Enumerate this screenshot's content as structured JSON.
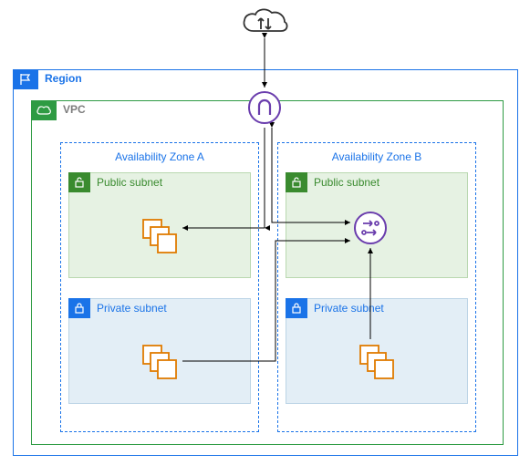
{
  "region": {
    "label": "Region"
  },
  "vpc": {
    "label": "VPC"
  },
  "availability_zones": {
    "a": {
      "label": "Availability Zone A",
      "public_subnet": {
        "label": "Public subnet",
        "resource": "instance-stack"
      },
      "private_subnet": {
        "label": "Private subnet",
        "resource": "instance-stack"
      }
    },
    "b": {
      "label": "Availability Zone B",
      "public_subnet": {
        "label": "Public subnet",
        "resource": "nat-gateway"
      },
      "private_subnet": {
        "label": "Private subnet",
        "resource": "instance-stack"
      }
    }
  },
  "icons": {
    "internet": "cloud",
    "internet_gateway": "igw",
    "nat_gateway": "nat"
  },
  "connections": [
    {
      "from": "internet",
      "to": "internet_gateway",
      "bidirectional": true
    },
    {
      "from": "internet_gateway",
      "to": "az_a.public_subnet.resource",
      "bidirectional": true
    },
    {
      "from": "internet_gateway",
      "to": "az_b.public_subnet.nat_gateway",
      "bidirectional": true
    },
    {
      "from": "az_a.private_subnet.resource",
      "to": "az_b.public_subnet.nat_gateway",
      "bidirectional": false
    },
    {
      "from": "az_b.private_subnet.resource",
      "to": "az_b.public_subnet.nat_gateway",
      "bidirectional": false
    }
  ],
  "colors": {
    "region_border": "#1a73e8",
    "vpc_border": "#2e9b43",
    "az_border": "#1a73e8",
    "public_fill": "#e6f2e3",
    "private_fill": "#e3eef6",
    "resource_stroke": "#e07b00",
    "gateway_stroke": "#6a3dad"
  }
}
